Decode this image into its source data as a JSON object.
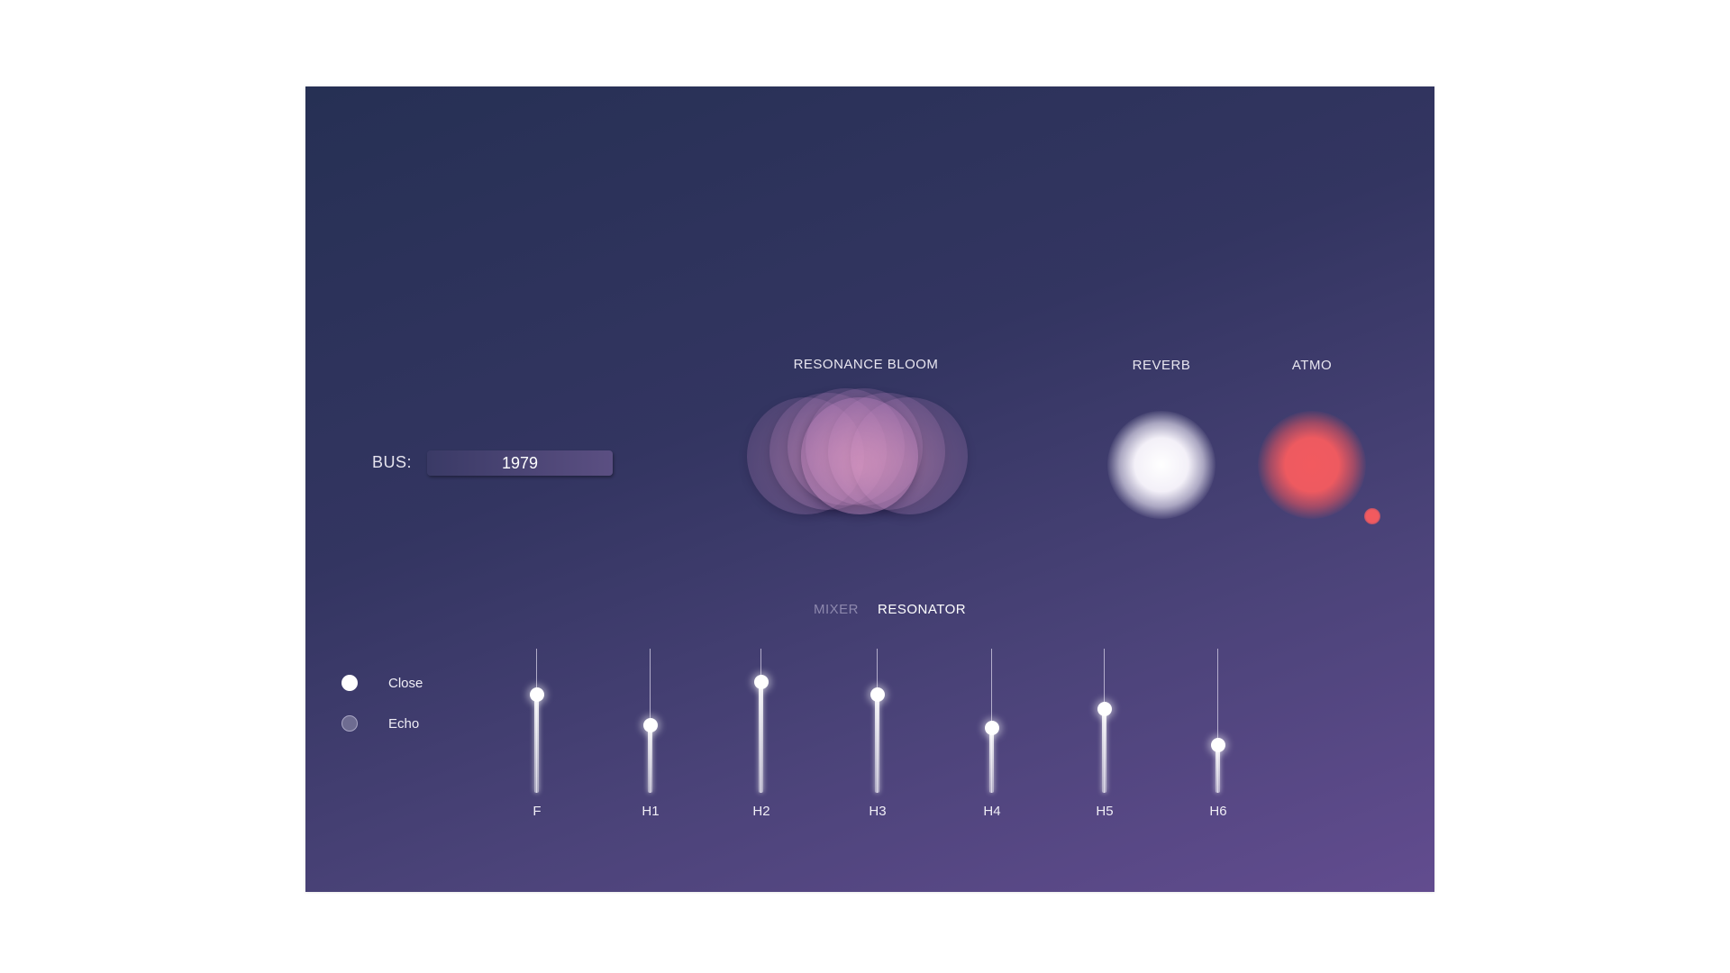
{
  "bus": {
    "label": "BUS:",
    "value": "1979"
  },
  "bloom": {
    "title": "RESONANCE BLOOM"
  },
  "reverb": {
    "title": "REVERB",
    "color": "#f4f2f8"
  },
  "atmo": {
    "title": "ATMO",
    "color": "#ee5a60"
  },
  "tabs": [
    {
      "label": "MIXER",
      "active": false
    },
    {
      "label": "RESONATOR",
      "active": true
    }
  ],
  "modes": [
    {
      "label": "Close",
      "selected": true
    },
    {
      "label": "Echo",
      "selected": false
    }
  ],
  "sliders": [
    {
      "label": "F",
      "level": 0.68
    },
    {
      "label": "H1",
      "level": 0.47
    },
    {
      "label": "H2",
      "level": 0.77
    },
    {
      "label": "H3",
      "level": 0.68
    },
    {
      "label": "H4",
      "level": 0.45
    },
    {
      "label": "H5",
      "level": 0.58
    },
    {
      "label": "H6",
      "level": 0.33
    }
  ]
}
